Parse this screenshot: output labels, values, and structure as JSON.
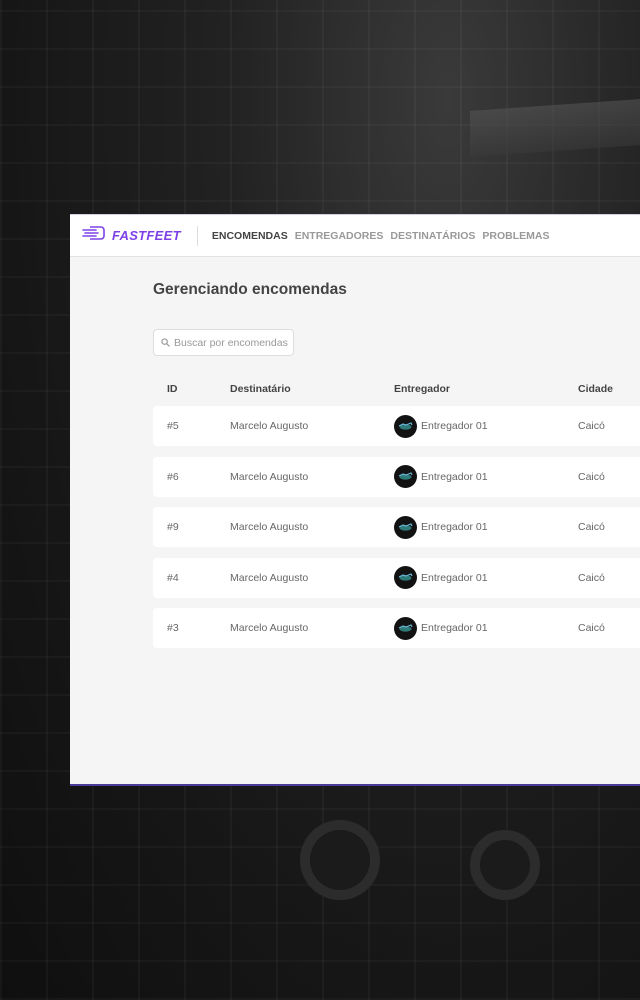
{
  "header": {
    "logo_text": "FASTFEET",
    "nav": [
      {
        "label": "ENCOMENDAS",
        "active": true
      },
      {
        "label": "ENTREGADORES",
        "active": false
      },
      {
        "label": "DESTINATÁRIOS",
        "active": false
      },
      {
        "label": "PROBLEMAS",
        "active": false
      }
    ]
  },
  "main": {
    "title": "Gerenciando encomendas",
    "search": {
      "placeholder": "Buscar por encomendas",
      "value": ""
    },
    "table": {
      "columns": [
        "ID",
        "Destinatário",
        "Entregador",
        "Cidade"
      ],
      "rows": [
        {
          "id": "#5",
          "recipient": "Marcelo Augusto",
          "deliveryman": "Entregador 01",
          "city": "Caicó"
        },
        {
          "id": "#6",
          "recipient": "Marcelo Augusto",
          "deliveryman": "Entregador 01",
          "city": "Caicó"
        },
        {
          "id": "#9",
          "recipient": "Marcelo Augusto",
          "deliveryman": "Entregador 01",
          "city": "Caicó"
        },
        {
          "id": "#4",
          "recipient": "Marcelo Augusto",
          "deliveryman": "Entregador 01",
          "city": "Caicó"
        },
        {
          "id": "#3",
          "recipient": "Marcelo Augusto",
          "deliveryman": "Entregador 01",
          "city": "Caicó"
        }
      ]
    }
  },
  "colors": {
    "brand": "#7d40e7",
    "text_dark": "#444444",
    "text_muted": "#999999"
  },
  "icons": {
    "logo": "fast-truck-icon",
    "search": "search-icon",
    "avatar": "avatar-icon"
  }
}
